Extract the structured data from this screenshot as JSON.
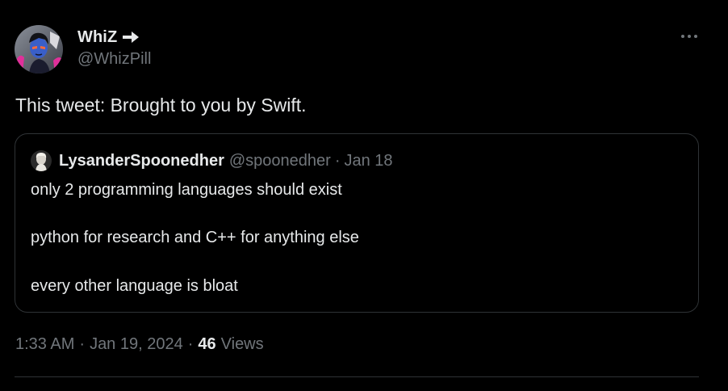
{
  "author": {
    "name": "WhiZ",
    "name_suffix_icon": "right-arrow-icon",
    "handle": "@WhizPill",
    "avatar_icon": "avatar-image"
  },
  "more_icon": "more-horizontal-icon",
  "tweet": {
    "text": "This tweet: Brought to you by Swift."
  },
  "quote": {
    "author_name": "LysanderSpoonedher",
    "author_handle": "@spoonedher",
    "separator": "·",
    "date": "Jan 18",
    "lines": [
      "only 2 programming languages should exist",
      "python for research and C++ for anything else",
      "every other language is bloat"
    ]
  },
  "meta": {
    "time": "1:33 AM",
    "separator": "·",
    "date": "Jan 19, 2024",
    "views_count": "46",
    "views_label": "Views"
  },
  "colors": {
    "background": "#000000",
    "text_primary": "#e7e9ea",
    "text_secondary": "#71767b",
    "border": "#2f3336"
  }
}
